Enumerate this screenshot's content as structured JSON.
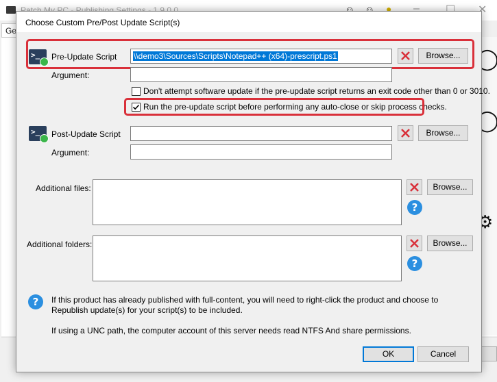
{
  "background_window": {
    "title": "Patch My PC - Publishing Settings - 1.9.0.0",
    "tab_label": "Gen"
  },
  "dialog": {
    "title": "Choose Custom Pre/Post Update Script(s)"
  },
  "pre_update": {
    "label": "Pre-Update Script",
    "path_value": "\\\\demo3\\Sources\\Scripts\\Notepad++ (x64)-prescript.ps1",
    "argument_label": "Argument:",
    "argument_value": "",
    "browse_label": "Browse...",
    "checkbox_exit_code_label": "Don't attempt software update if the pre-update script returns an exit code other than 0 or 3010.",
    "checkbox_exit_code_checked": false,
    "checkbox_run_before_label": "Run the pre-update script before performing any auto-close or skip process checks.",
    "checkbox_run_before_checked": true
  },
  "post_update": {
    "label": "Post-Update Script",
    "path_value": "",
    "argument_label": "Argument:",
    "argument_value": "",
    "browse_label": "Browse..."
  },
  "additional_files": {
    "label": "Additional files:",
    "browse_label": "Browse..."
  },
  "additional_folders": {
    "label": "Additional folders:",
    "browse_label": "Browse..."
  },
  "info": {
    "line1": "If this product has already published with full-content, you will need to right-click the product and choose to",
    "line2": "Republish update(s) for your script(s) to be included.",
    "line3": "If using a UNC path, the computer account of this server needs read NTFS And share permissions."
  },
  "footer": {
    "ok_label": "OK",
    "cancel_label": "Cancel"
  },
  "colors": {
    "highlight_box": "#d9303a",
    "selection": "#0078d7",
    "help_icon": "#2b8fe0",
    "clear_icon": "#d9303a"
  },
  "icons": {
    "script_icon": "powershell-icon",
    "clear_icon": "red-x-icon",
    "help_icon": "question-icon",
    "checkmark_icon": "checkmark-icon"
  }
}
